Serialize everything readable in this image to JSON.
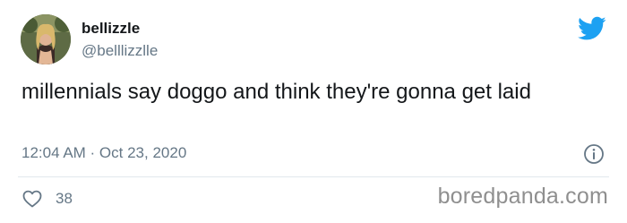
{
  "author": {
    "display_name": "bellizzle",
    "handle": "@belllizzlle",
    "avatar_icon": "profile-photo"
  },
  "platform_icon": "twitter-bird-icon",
  "tweet": {
    "text": "millennials say doggo and think they're gonna get laid",
    "timestamp": "12:04 AM · Oct 23, 2020"
  },
  "actions": {
    "like_icon": "heart-outline-icon",
    "like_count": "38",
    "info_icon": "info-circle-icon"
  },
  "watermark": "boredpanda.com",
  "colors": {
    "twitter_blue": "#1da1f2",
    "text_primary": "#14171a",
    "text_secondary": "#657786",
    "divider": "#e1e8ed",
    "watermark": "#8f8f8f"
  }
}
